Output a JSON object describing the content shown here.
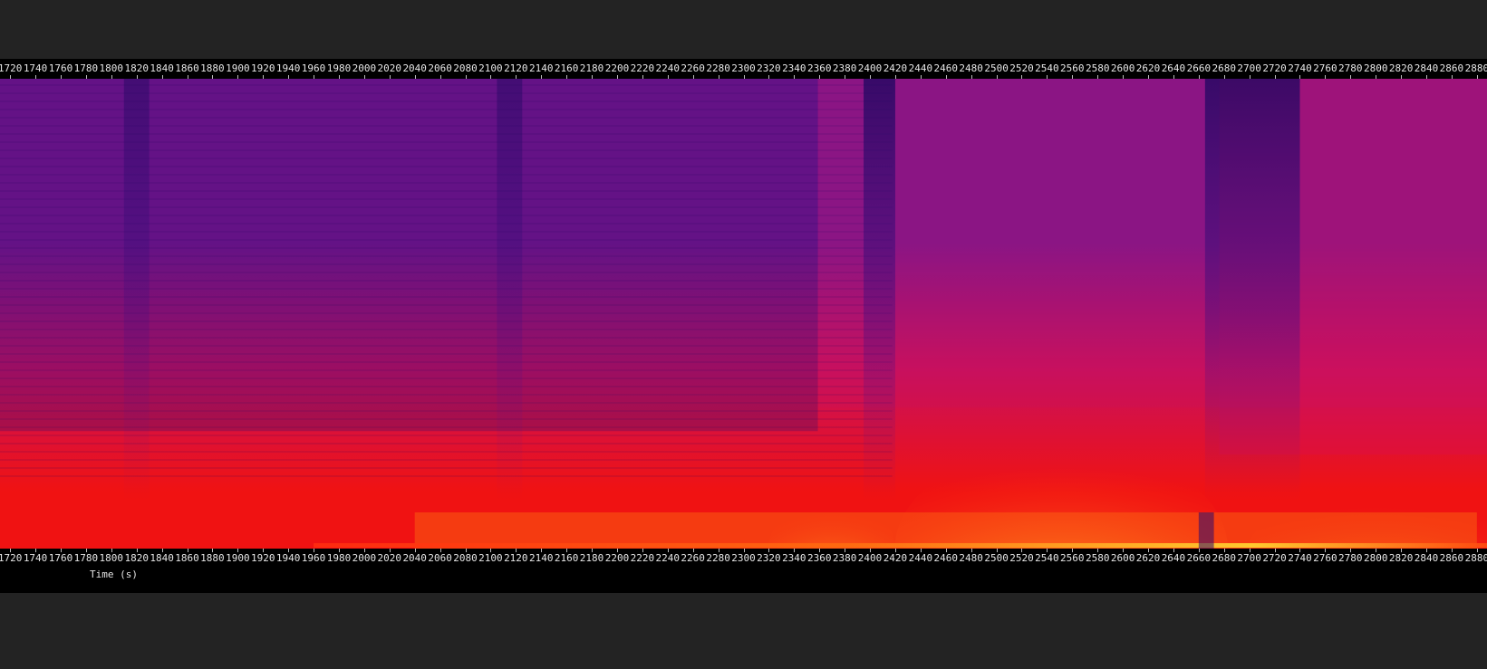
{
  "chart_data": {
    "type": "heatmap",
    "xlabel": "Time (s)",
    "ylabel": "",
    "title": "",
    "colormap": "inferno-like (dark purple → magenta → red → orange → yellow)",
    "xlim": [
      1712,
      2888
    ],
    "x_ticks": [
      1720,
      1740,
      1760,
      1780,
      1800,
      1820,
      1840,
      1860,
      1880,
      1900,
      1920,
      1940,
      1960,
      1980,
      2000,
      2020,
      2040,
      2060,
      2080,
      2100,
      2120,
      2140,
      2160,
      2180,
      2200,
      2220,
      2240,
      2260,
      2280,
      2300,
      2320,
      2340,
      2360,
      2380,
      2400,
      2420,
      2440,
      2460,
      2480,
      2500,
      2520,
      2540,
      2560,
      2580,
      2600,
      2620,
      2640,
      2660,
      2680,
      2700,
      2720,
      2740,
      2760,
      2780,
      2800,
      2820,
      2840,
      2860,
      2880
    ],
    "tick_labels_top": true,
    "tick_labels_bottom": true,
    "grid": false,
    "legend": "none",
    "colors": {
      "low": "#2c0a6e",
      "mid_low": "#7a168f",
      "mid": "#c8105e",
      "mid_high": "#f01212",
      "high": "#ff8a12",
      "peak": "#ffe040"
    },
    "features": [
      {
        "x_start": 1810,
        "x_end": 1830,
        "intensity": "low"
      },
      {
        "x_start": 2105,
        "x_end": 2125,
        "intensity": "low"
      },
      {
        "x_start": 2395,
        "x_end": 2420,
        "intensity": "very low"
      },
      {
        "x_start": 2665,
        "x_end": 2740,
        "intensity": "very low"
      },
      {
        "x_start": 2520,
        "x_end": 2640,
        "intensity": "peak at low frequencies"
      }
    ]
  }
}
